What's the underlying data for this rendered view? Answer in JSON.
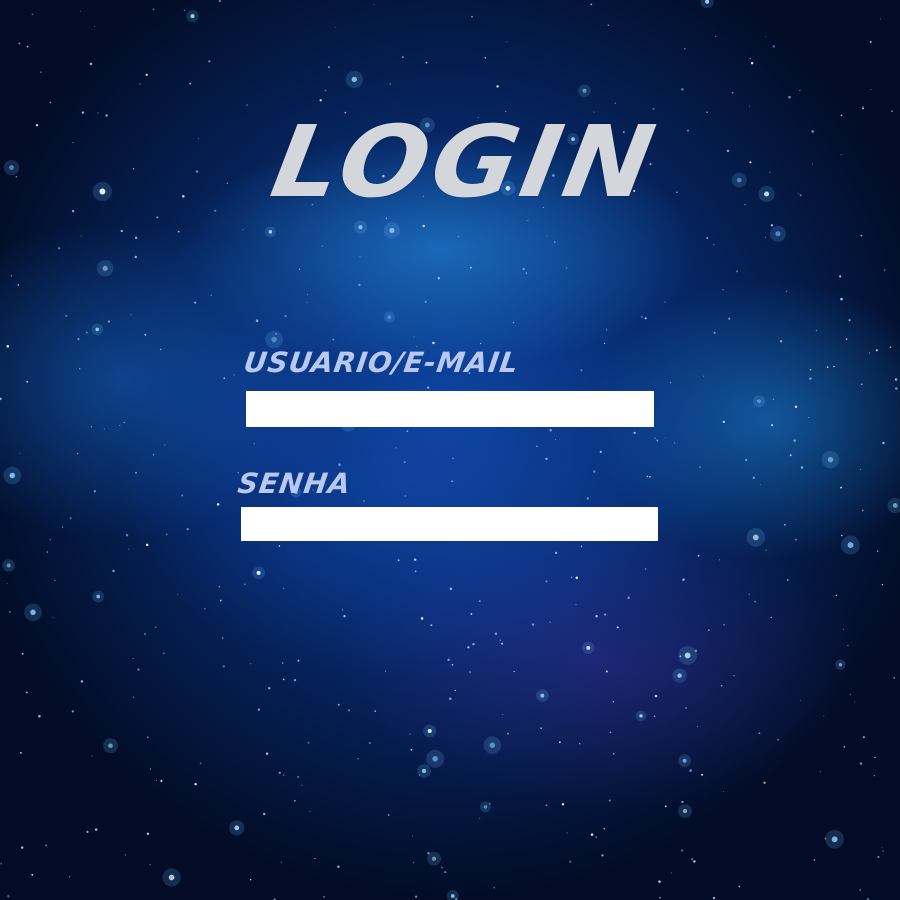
{
  "login": {
    "title": "LOGIN",
    "username": {
      "label": "USUARIO/E-MAIL",
      "value": ""
    },
    "password": {
      "label": "SENHA",
      "value": ""
    }
  },
  "colors": {
    "title_text": "#d3d6db",
    "label_text": "#b9c8ee",
    "input_background": "#ffffff",
    "background_core": "#0b3f94",
    "background_edge": "#020c26"
  }
}
